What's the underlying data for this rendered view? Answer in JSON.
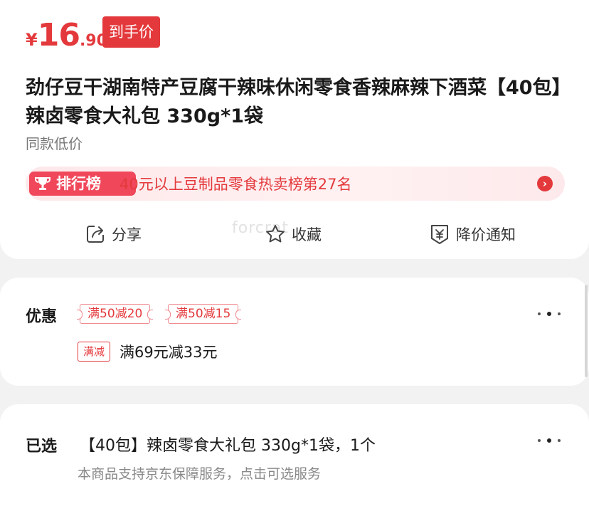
{
  "price": {
    "currency": "¥",
    "integer": "16",
    "decimal": ".90",
    "badge": "到手价"
  },
  "product": {
    "title": "劲仔豆干湖南特产豆腐干辣味休闲零食香辣麻辣下酒菜【40包】辣卤零食大礼包 330g*1袋",
    "sub_note": "同款低价"
  },
  "ranking": {
    "badge": "排行榜",
    "text": "40元以上豆制品零食热卖榜第27名",
    "arrow": "›"
  },
  "actions": [
    {
      "label": "分享",
      "icon": "share-icon"
    },
    {
      "label": "收藏",
      "icon": "star-icon"
    },
    {
      "label": "降价通知",
      "icon": "price-alert-icon"
    }
  ],
  "watermark": "forcrat",
  "promo": {
    "label": "优惠",
    "coupons": [
      "满50减20",
      "满50减15"
    ],
    "tag": "满减",
    "deal": "满69元减33元"
  },
  "selected": {
    "label": "已选",
    "value": "【40包】辣卤零食大礼包 330g*1袋，1个",
    "service_note": "本商品支持京东保障服务，点击可选服务"
  },
  "colors": {
    "accent": "#e4393c",
    "rank_badge": "#f0475a",
    "background": "#f2f2f2"
  }
}
